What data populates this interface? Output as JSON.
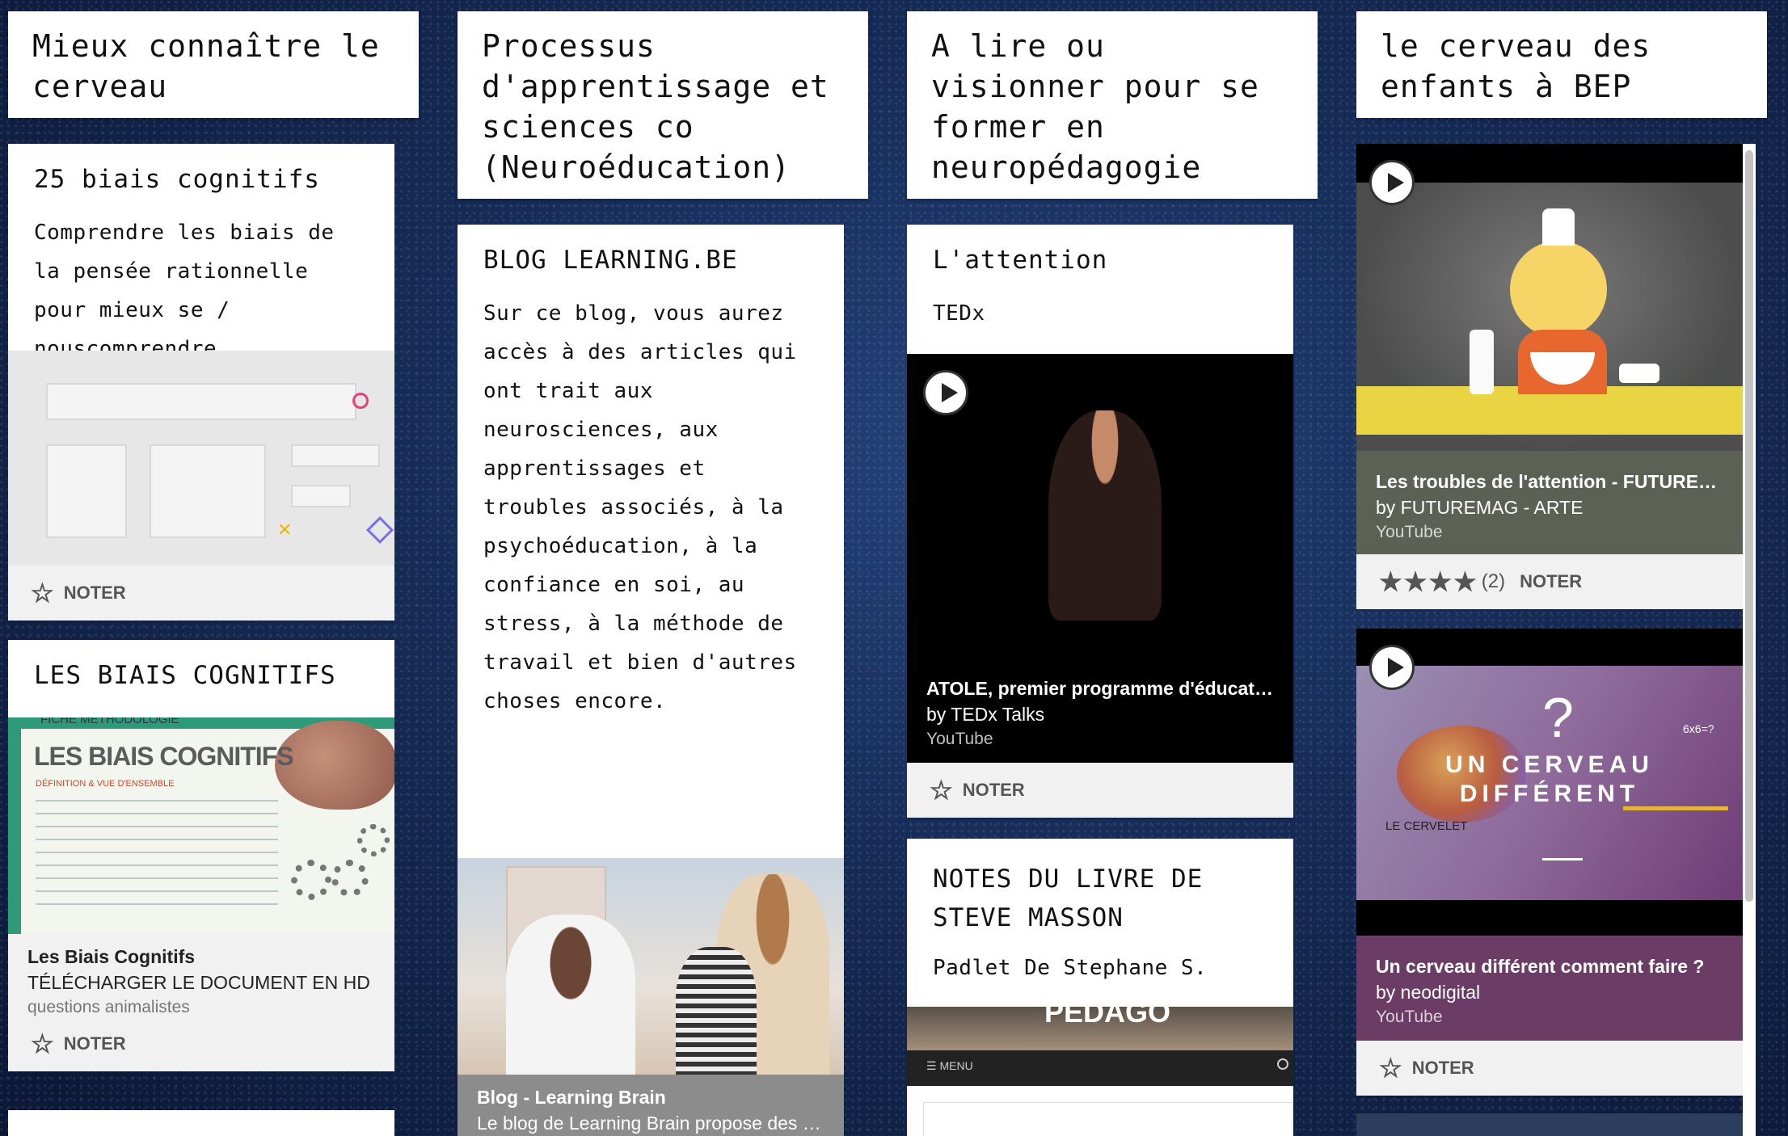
{
  "columns": [
    {
      "title": "Mieux connaître le cerveau"
    },
    {
      "title": "Processus d'apprentissage et sciences co (Neuroéducation)"
    },
    {
      "title": "A lire ou visionner pour se former en neuropédagogie"
    },
    {
      "title": "le cerveau des enfants à BEP"
    }
  ],
  "col1": {
    "card1": {
      "title": "25 biais cognitifs",
      "body": "Comprendre les biais de la pensée rationnelle pour mieux se / nouscomprendre",
      "footer": "NOTER"
    },
    "card2": {
      "title": "LES BIAIS COGNITIFS",
      "image_heading": "LES BIAIS COGNITIFS",
      "image_top": "FICHE MÉTHODOLOGIE",
      "image_sub": "DÉFINITION & VUE D'ENSEMBLE",
      "meta_title": "Les Biais Cognitifs",
      "meta_sub": "TÉLÉCHARGER LE DOCUMENT EN HD (...",
      "meta_source": "questions animalistes",
      "footer": "NOTER"
    }
  },
  "col2": {
    "card1": {
      "title": "BLOG LEARNING.BE",
      "body": "Sur ce blog, vous aurez accès à des articles qui ont trait aux neurosciences, aux apprentissages et troubles associés, à la psychoéducation, à la confiance en soi, au stress, à la méthode de travail et bien d'autres choses encore.",
      "meta_title": "Blog - Learning Brain",
      "meta_sub": "Le blog de Learning Brain propose des in..."
    }
  },
  "col3": {
    "card1": {
      "title": "L'attention",
      "body": "TEDx",
      "meta_title": "ATOLE, premier programme d'éducation ...",
      "meta_sub": "by TEDx Talks",
      "meta_source": "YouTube",
      "footer": "NOTER"
    },
    "card2": {
      "title": "NOTES DU LIVRE DE STEVE MASSON",
      "body": "Padlet De Stephane S.",
      "image_text": "PÉDAGO",
      "menu": "MENU"
    }
  },
  "col4": {
    "card1": {
      "meta_title": "Les troubles de l'attention - FUTUREMA...",
      "meta_sub": "by FUTUREMAG - ARTE",
      "meta_source": "YouTube",
      "rating_stars": "★★★★",
      "rating_count": "(2)",
      "footer": "NOTER"
    },
    "card2": {
      "image_line1": "UN CERVEAU",
      "image_line2": "DIFFÉRENT",
      "image_label": "LE CERVELET",
      "image_eq": "6x6=?",
      "meta_title": "Un cerveau différent comment faire ?",
      "meta_sub": "by neodigital",
      "meta_source": "YouTube",
      "footer": "NOTER"
    }
  },
  "colors": {
    "accent_play": "#ffffff",
    "meta_gray": "#5c6156",
    "meta_purple": "#6b3d66",
    "meta_dark": "#000000"
  }
}
